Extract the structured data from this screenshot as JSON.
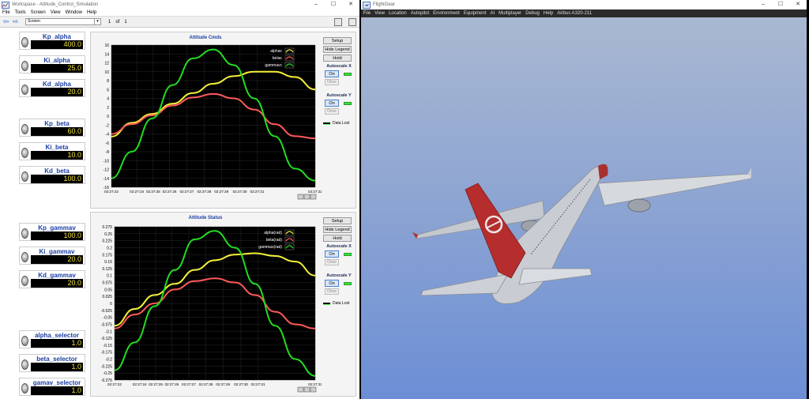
{
  "workspace": {
    "title": "Workspace - Attitude_Control_Simulation",
    "menu": [
      "File",
      "Tools",
      "Screen",
      "View",
      "Window",
      "Help"
    ],
    "screen_select": "Screen",
    "pager": {
      "current": "1",
      "of": "of",
      "total": "1"
    },
    "knobs": [
      {
        "label": "Kp_alpha",
        "value": "400.0"
      },
      {
        "label": "Ki_alpha",
        "value": "25.0"
      },
      {
        "label": "Kd_alpha",
        "value": "20.0"
      },
      {
        "label": "Kp_beta",
        "value": "60.0"
      },
      {
        "label": "Ki_beta",
        "value": "10.0"
      },
      {
        "label": "Kd_beta",
        "value": "100.0"
      },
      {
        "label": "Kp_gammav",
        "value": "100.0"
      },
      {
        "label": "Ki_gammav",
        "value": "20.0"
      },
      {
        "label": "Kd_gammav",
        "value": "20.0"
      },
      {
        "label": "alpha_selector",
        "value": "1.0"
      },
      {
        "label": "beta_selector",
        "value": "1.0"
      },
      {
        "label": "gamav_selector",
        "value": "1.0"
      }
    ],
    "side_controls": {
      "setup": "Setup",
      "hide_legend": "Hide Legend",
      "hold": "Hold",
      "autoscale_x": "Autoscale X",
      "autoscale_y": "Autoscale Y",
      "on": "On",
      "once": "Once",
      "data_lost": "Data Lost"
    },
    "colors": {
      "alpha": "#f5f03a",
      "beta": "#ff5a5a",
      "gamma": "#22dd22"
    }
  },
  "chart_data": [
    {
      "type": "line",
      "title": "Attitude Cmds",
      "x": [
        "02:27:22",
        "02:27:24",
        "02:27:25",
        "02:27:26",
        "02:27:27",
        "02:27:28",
        "02:27:29",
        "02:27:30",
        "02:27:31",
        "02:27:32"
      ],
      "ylim": [
        -16,
        16
      ],
      "yticks": [
        16,
        14,
        12,
        10,
        8,
        6,
        4,
        2,
        0,
        -2,
        -4,
        -6,
        -8,
        -10,
        -12,
        -14,
        -16
      ],
      "series": [
        {
          "name": "alphac",
          "color": "#f5f03a",
          "points": [
            [
              0,
              -4.6
            ],
            [
              1,
              -1.5
            ],
            [
              2,
              0.5
            ],
            [
              3,
              2.8
            ],
            [
              4,
              5.2
            ],
            [
              5,
              7.3
            ],
            [
              6,
              9.0
            ],
            [
              7,
              10.0
            ],
            [
              8,
              10.0
            ],
            [
              9,
              8.8
            ],
            [
              10,
              6.0
            ]
          ]
        },
        {
          "name": "betac",
          "color": "#ff5a5a",
          "points": [
            [
              0,
              -4.0
            ],
            [
              1,
              -1.8
            ],
            [
              2,
              0.2
            ],
            [
              3,
              2.4
            ],
            [
              4,
              4.2
            ],
            [
              5,
              5.0
            ],
            [
              6,
              4.0
            ],
            [
              7,
              1.5
            ],
            [
              8,
              -1.8
            ],
            [
              9,
              -4.5
            ],
            [
              10,
              -5.0
            ]
          ]
        },
        {
          "name": "gammavc",
          "color": "#22dd22",
          "points": [
            [
              0,
              -14.0
            ],
            [
              1,
              -8.0
            ],
            [
              2,
              -0.5
            ],
            [
              3,
              7.0
            ],
            [
              4,
              13.0
            ],
            [
              5,
              15.0
            ],
            [
              6,
              11.5
            ],
            [
              7,
              4.0
            ],
            [
              8,
              -4.5
            ],
            [
              9,
              -11.8
            ],
            [
              10,
              -14.5
            ]
          ]
        }
      ]
    },
    {
      "type": "line",
      "title": "Attitude Status",
      "x": [
        "02:27:22",
        "02:27:24",
        "02:27:25",
        "02:27:26",
        "02:27:27",
        "02:27:28",
        "02:27:29",
        "02:27:30",
        "02:27:31",
        "02:27:32"
      ],
      "ylim": [
        -0.275,
        0.275
      ],
      "yticks": [
        0.275,
        0.25,
        0.225,
        0.2,
        0.175,
        0.15,
        0.125,
        0.1,
        0.075,
        0.05,
        0.025,
        0,
        -0.025,
        -0.05,
        -0.075,
        -0.1,
        -0.125,
        -0.15,
        -0.175,
        -0.2,
        -0.225,
        -0.25,
        -0.275
      ],
      "series": [
        {
          "name": "alpha(rad)",
          "color": "#f5f03a",
          "points": [
            [
              0,
              -0.08
            ],
            [
              1,
              -0.02
            ],
            [
              2,
              0.03
            ],
            [
              3,
              0.07
            ],
            [
              4,
              0.12
            ],
            [
              5,
              0.155
            ],
            [
              6,
              0.175
            ],
            [
              7,
              0.18
            ],
            [
              8,
              0.17
            ],
            [
              9,
              0.15
            ],
            [
              10,
              0.1
            ]
          ]
        },
        {
          "name": "beta(rad)",
          "color": "#ff5a5a",
          "points": [
            [
              0,
              -0.09
            ],
            [
              1,
              -0.04
            ],
            [
              2,
              0.0
            ],
            [
              3,
              0.05
            ],
            [
              4,
              0.08
            ],
            [
              5,
              0.09
            ],
            [
              6,
              0.075
            ],
            [
              7,
              0.03
            ],
            [
              8,
              -0.03
            ],
            [
              9,
              -0.075
            ],
            [
              10,
              -0.09
            ]
          ]
        },
        {
          "name": "gammav(rad)",
          "color": "#22dd22",
          "points": [
            [
              0,
              -0.24
            ],
            [
              1,
              -0.14
            ],
            [
              2,
              -0.01
            ],
            [
              3,
              0.12
            ],
            [
              4,
              0.23
            ],
            [
              5,
              0.26
            ],
            [
              6,
              0.2
            ],
            [
              7,
              0.07
            ],
            [
              8,
              -0.08
            ],
            [
              9,
              -0.2
            ],
            [
              10,
              -0.26
            ]
          ]
        }
      ]
    }
  ],
  "flightgear": {
    "title": "FlightGear",
    "menu": [
      "File",
      "View",
      "Location",
      "Autopilot",
      "Environment",
      "Equipment",
      "AI",
      "Multiplayer",
      "Debug",
      "Help",
      "Airbus A320-211"
    ]
  }
}
